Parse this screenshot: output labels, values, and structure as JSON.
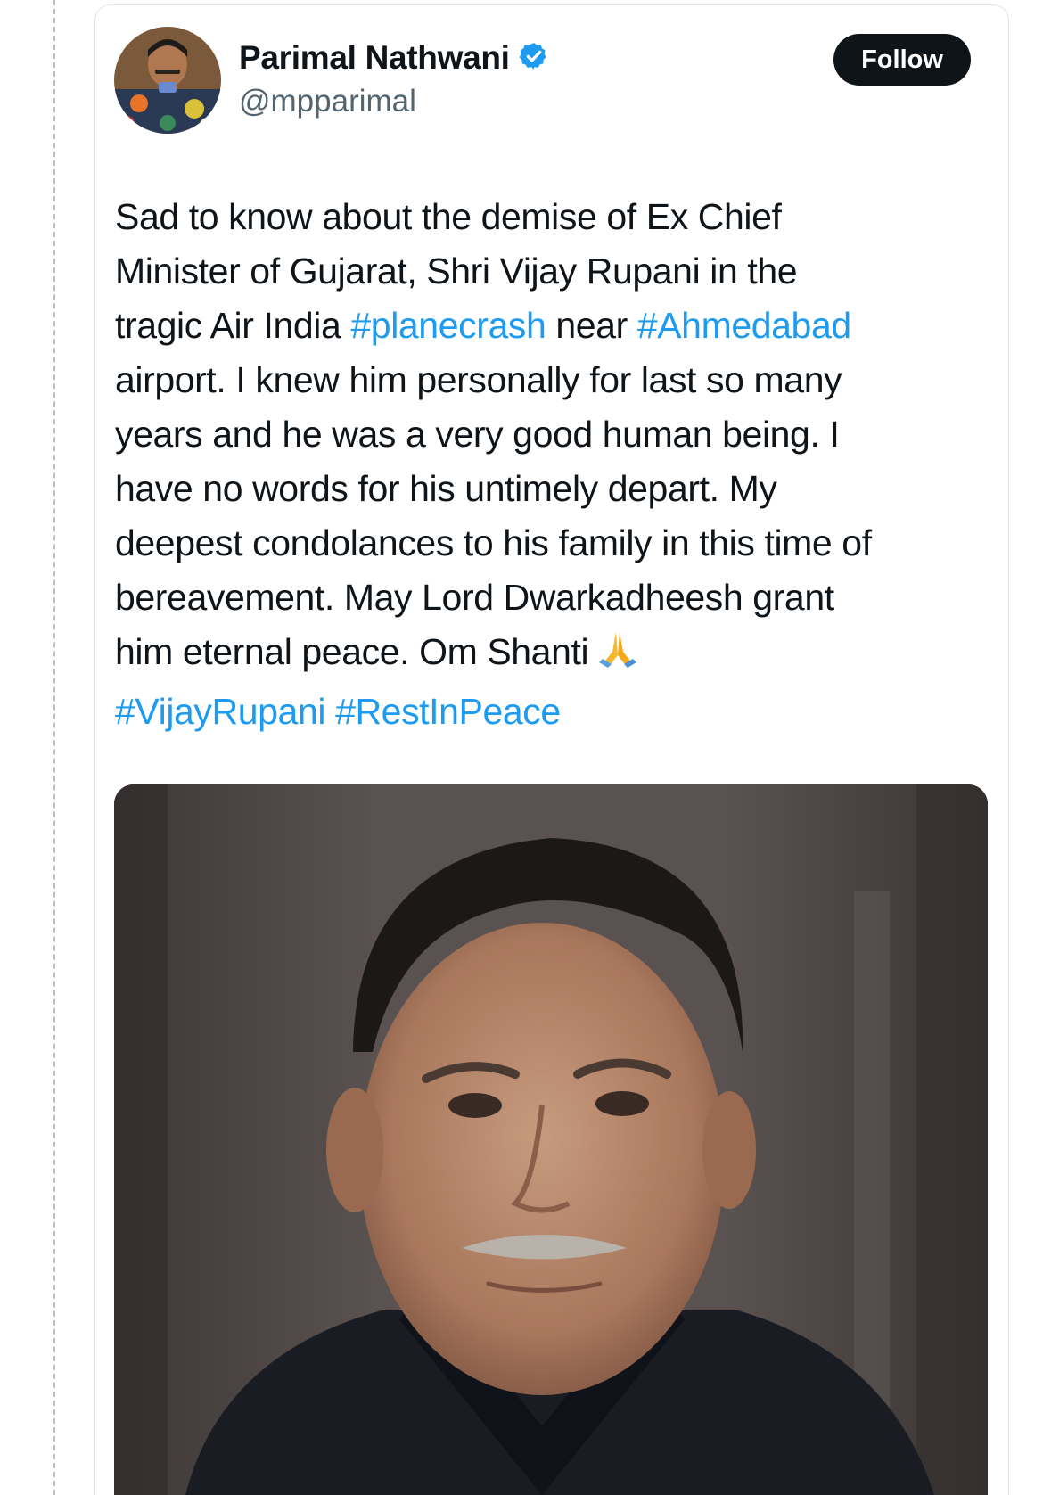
{
  "tweet": {
    "author_name": "Parimal Nathwani",
    "author_handle": "@mpparimal",
    "verified": true,
    "follow_label": "Follow",
    "lines": [
      [
        {
          "text": "Sad to know about the demise of Ex Chief",
          "type": "text"
        }
      ],
      [
        {
          "text": "Minister of Gujarat, Shri Vijay Rupani in the",
          "type": "text"
        }
      ],
      [
        {
          "text": "tragic Air India ",
          "type": "text"
        },
        {
          "text": "#planecrash",
          "type": "hashtag"
        },
        {
          "text": " near ",
          "type": "text"
        },
        {
          "text": "#Ahmedabad",
          "type": "hashtag"
        }
      ],
      [
        {
          "text": "airport. I knew him personally for last so many",
          "type": "text"
        }
      ],
      [
        {
          "text": "years and he was a very good human being. I",
          "type": "text"
        }
      ],
      [
        {
          "text": "have no words for his untimely depart. My",
          "type": "text"
        }
      ],
      [
        {
          "text": "deepest condolances to his family in this time of",
          "type": "text"
        }
      ],
      [
        {
          "text": "bereavement. May Lord Dwarkadheesh grant",
          "type": "text"
        }
      ],
      [
        {
          "text": "him eternal peace. Om Shanti",
          "type": "text"
        },
        {
          "text": "folded-hands-emoji",
          "type": "emoji"
        }
      ],
      [
        {
          "text": "#VijayRupani",
          "type": "hashtag"
        },
        {
          "text": " ",
          "type": "text"
        },
        {
          "text": "#RestInPeace",
          "type": "hashtag"
        }
      ]
    ]
  },
  "colors": {
    "text": "#0f1419",
    "secondary": "#536471",
    "link": "#1d9bf0",
    "verified_badge": "#1d9bf0",
    "follow_bg": "#0f1419"
  },
  "icons": {
    "verified": "verified-badge-icon",
    "emoji": "folded-hands-emoji"
  }
}
